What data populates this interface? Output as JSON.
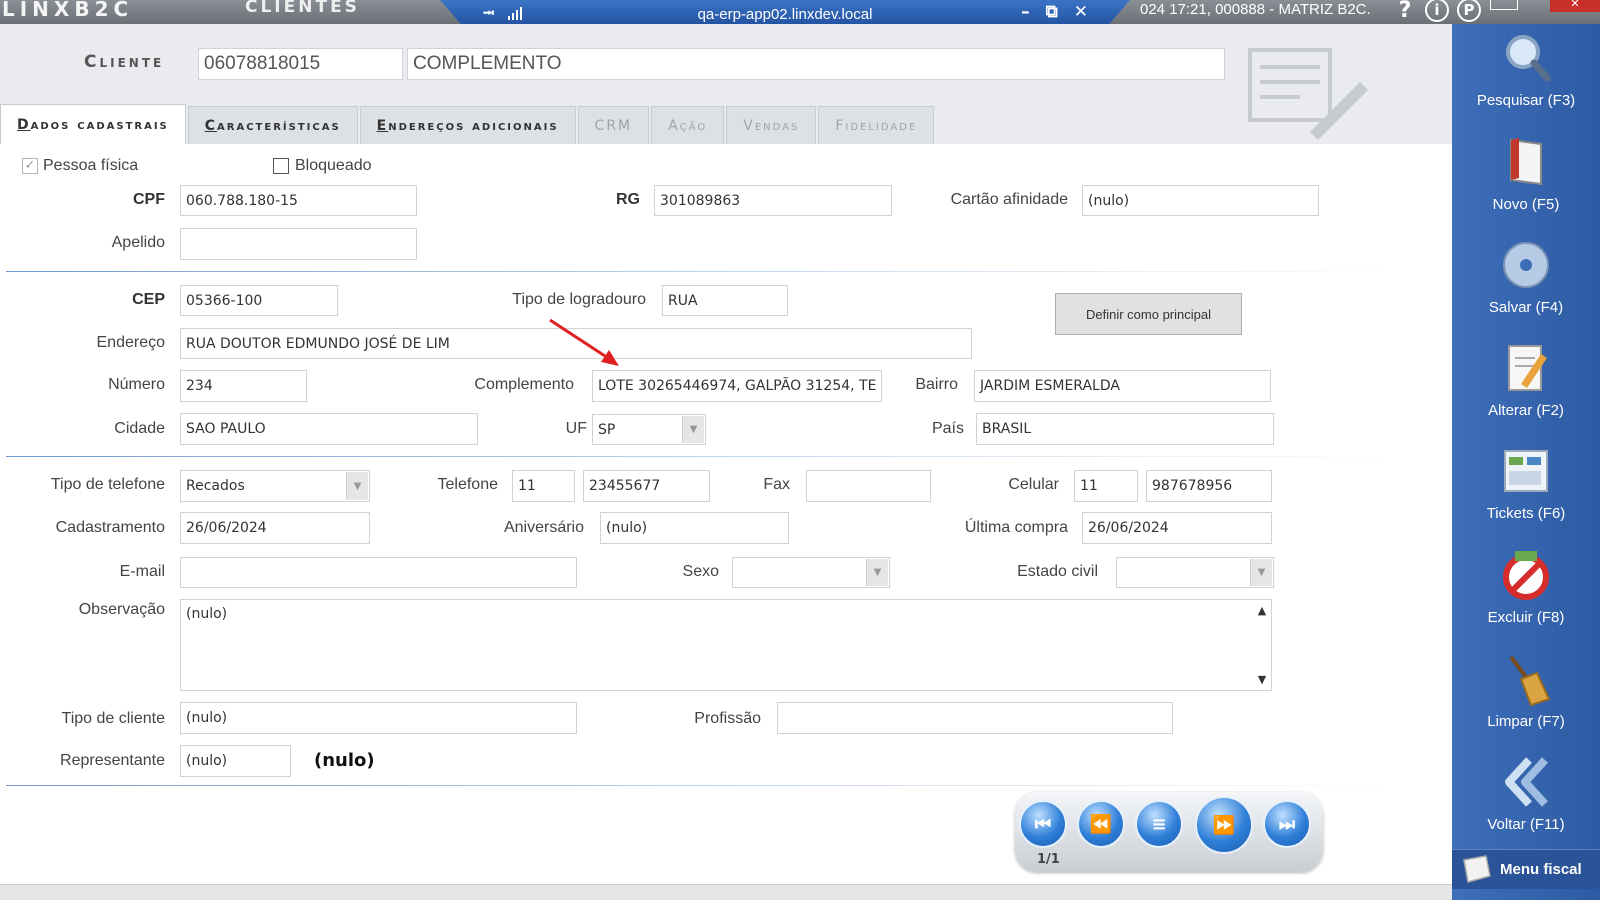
{
  "topbar": {
    "brand": "LINXB2C",
    "module": "CLIENTES",
    "remote_host": "qa-erp-app02.linxdev.local",
    "status": "024 17:21, 000888 - MATRIZ B2C.",
    "help_icon": "?",
    "info_icon": "i",
    "p_icon": "P"
  },
  "header": {
    "cliente_label": "Cliente",
    "cliente_code": "06078818015",
    "cliente_name": "COMPLEMENTO"
  },
  "tabs": [
    {
      "first": "D",
      "rest": "ados cadastrais",
      "state": "active"
    },
    {
      "first": "C",
      "rest": "aracterísticas",
      "state": "normal"
    },
    {
      "first": "E",
      "rest": "ndereços adicionais",
      "state": "normal"
    },
    {
      "label": "CRM",
      "state": "disabled"
    },
    {
      "label": "Ação",
      "state": "disabled"
    },
    {
      "label": "Vendas",
      "state": "disabled"
    },
    {
      "label": "Fidelidade",
      "state": "disabled"
    }
  ],
  "form": {
    "pessoa_fisica_label": "Pessoa física",
    "pessoa_fisica_checked": true,
    "bloqueado_label": "Bloqueado",
    "bloqueado_checked": false,
    "cpf_label": "CPF",
    "cpf": "060.788.180-15",
    "rg_label": "RG",
    "rg": "301089863",
    "cartao_label": "Cartão afinidade",
    "cartao": "(nulo)",
    "apelido_label": "Apelido",
    "apelido": "",
    "cep_label": "CEP",
    "cep": "05366-100",
    "tipo_logradouro_label": "Tipo de logradouro",
    "tipo_logradouro": "RUA",
    "definir_principal": "Definir como principal",
    "endereco_label": "Endereço",
    "endereco": "RUA DOUTOR EDMUNDO JOSÉ DE LIM",
    "numero_label": "Número",
    "numero": "234",
    "complemento_label": "Complemento",
    "complemento": "LOTE 30265446974, GALPÃO 31254, TE",
    "bairro_label": "Bairro",
    "bairro": "JARDIM ESMERALDA",
    "cidade_label": "Cidade",
    "cidade": "SAO PAULO",
    "uf_label": "UF",
    "uf": "SP",
    "pais_label": "País",
    "pais": "BRASIL",
    "tipo_telefone_label": "Tipo de telefone",
    "tipo_telefone": "Recados",
    "telefone_label": "Telefone",
    "telefone_ddd": "11",
    "telefone": "23455677",
    "fax_label": "Fax",
    "fax": "",
    "celular_label": "Celular",
    "celular_ddd": "11",
    "celular": "987678956",
    "cadastramento_label": "Cadastramento",
    "cadastramento": "26/06/2024",
    "aniversario_label": "Aniversário",
    "aniversario": "(nulo)",
    "ultima_compra_label": "Última compra",
    "ultima_compra": "26/06/2024",
    "email_label": "E-mail",
    "email": "",
    "sexo_label": "Sexo",
    "sexo": "",
    "estado_civil_label": "Estado civil",
    "estado_civil": "",
    "observacao_label": "Observação",
    "observacao": "(nulo)",
    "tipo_cliente_label": "Tipo de cliente",
    "tipo_cliente": "(nulo)",
    "profissao_label": "Profissão",
    "profissao": "",
    "representante_label": "Representante",
    "representante": "(nulo)",
    "representante_nome": "(nulo)"
  },
  "navigator": {
    "record_count": "1/1"
  },
  "sidebar": {
    "items": [
      {
        "label": "Pesquisar (F3)",
        "icon": "magnifier-icon"
      },
      {
        "label": "Novo (F5)",
        "icon": "new-document-icon"
      },
      {
        "label": "Salvar (F4)",
        "icon": "disk-icon"
      },
      {
        "label": "Alterar (F2)",
        "icon": "edit-icon"
      },
      {
        "label": "Tickets (F6)",
        "icon": "tickets-icon"
      },
      {
        "label": "Excluir (F8)",
        "icon": "delete-icon"
      },
      {
        "label": "Limpar (F7)",
        "icon": "broom-icon"
      },
      {
        "label": "Voltar (F11)",
        "icon": "back-icon"
      }
    ],
    "menu_fiscal": "Menu fiscal"
  },
  "colors": {
    "sidebar": "#3564af",
    "annotation_arrow": "#e02020",
    "separator": "#6e9ad0"
  }
}
